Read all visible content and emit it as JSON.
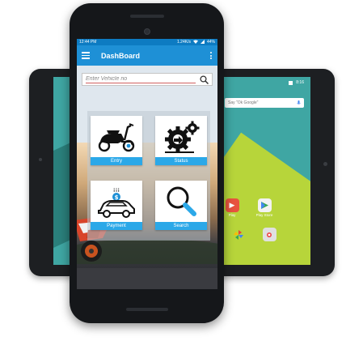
{
  "phone": {
    "status_bar": {
      "time": "12:44 PM",
      "network_speed": "1.24K/s",
      "battery": "44%"
    },
    "app_bar": {
      "title": "DashBoard"
    },
    "search": {
      "placeholder": "Enter Vehicle no",
      "value": ""
    },
    "tiles": [
      {
        "label": "Entry",
        "icon": "scooter-icon"
      },
      {
        "label": "Status",
        "icon": "gears-icon"
      },
      {
        "label": "Payment",
        "icon": "car-payment-icon"
      },
      {
        "label": "Search",
        "icon": "magnifier-icon"
      }
    ]
  },
  "tablet": {
    "status_bar": {
      "battery": "8:16"
    },
    "search_bar": {
      "placeholder": "Say \"Ok Google\""
    },
    "apps": [
      {
        "label": "Play",
        "color": "#e8533f"
      },
      {
        "label": "Play Store",
        "color": "#ffffff"
      }
    ]
  },
  "colors": {
    "app_bar": "#1e90d6",
    "status_bar": "#0d7bc2",
    "tile_caption": "#2ba8e8"
  }
}
